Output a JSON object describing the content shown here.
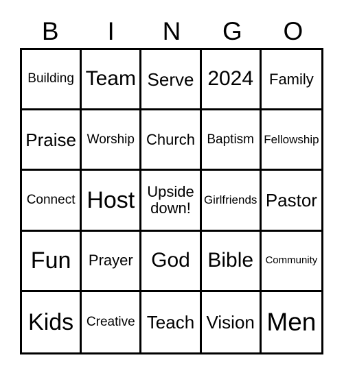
{
  "card": {
    "title": "BINGO",
    "columns": [
      "B",
      "I",
      "N",
      "G",
      "O"
    ],
    "border_color": "#000000",
    "background_color": "#ffffff",
    "text_color": "#000000",
    "rows": 5,
    "cols": 5
  },
  "header": {
    "letters": [
      {
        "label": "B"
      },
      {
        "label": "I"
      },
      {
        "label": "N"
      },
      {
        "label": "G"
      },
      {
        "label": "O"
      }
    ]
  },
  "grid": {
    "cells": [
      {
        "label": "Building",
        "size": "md",
        "row": 1,
        "col": 1
      },
      {
        "label": "Team",
        "size": "2xl",
        "row": 1,
        "col": 2
      },
      {
        "label": "Serve",
        "size": "xl",
        "row": 1,
        "col": 3
      },
      {
        "label": "2024",
        "size": "2xl",
        "row": 1,
        "col": 4
      },
      {
        "label": "Family",
        "size": "lg",
        "row": 1,
        "col": 5
      },
      {
        "label": "Praise",
        "size": "xl",
        "row": 2,
        "col": 1
      },
      {
        "label": "Worship",
        "size": "md",
        "row": 2,
        "col": 2
      },
      {
        "label": "Church",
        "size": "lg",
        "row": 2,
        "col": 3
      },
      {
        "label": "Baptism",
        "size": "md",
        "row": 2,
        "col": 4
      },
      {
        "label": "Fellowship",
        "size": "sm",
        "row": 2,
        "col": 5
      },
      {
        "label": "Connect",
        "size": "md",
        "row": 3,
        "col": 1
      },
      {
        "label": "Host",
        "size": "3xl",
        "row": 3,
        "col": 2
      },
      {
        "label": "Upside\ndown!",
        "size": "lg",
        "row": 3,
        "col": 3
      },
      {
        "label": "Girlfriends",
        "size": "sm",
        "row": 3,
        "col": 4
      },
      {
        "label": "Pastor",
        "size": "xl",
        "row": 3,
        "col": 5
      },
      {
        "label": "Fun",
        "size": "3xl",
        "row": 4,
        "col": 1
      },
      {
        "label": "Prayer",
        "size": "lg",
        "row": 4,
        "col": 2
      },
      {
        "label": "God",
        "size": "2xl",
        "row": 4,
        "col": 3
      },
      {
        "label": "Bible",
        "size": "2xl",
        "row": 4,
        "col": 4
      },
      {
        "label": "Community",
        "size": "xs",
        "row": 4,
        "col": 5
      },
      {
        "label": "Kids",
        "size": "3xl",
        "row": 5,
        "col": 1
      },
      {
        "label": "Creative",
        "size": "md",
        "row": 5,
        "col": 2
      },
      {
        "label": "Teach",
        "size": "xl",
        "row": 5,
        "col": 3
      },
      {
        "label": "Vision",
        "size": "xl",
        "row": 5,
        "col": 4
      },
      {
        "label": "Men",
        "size": "4xl",
        "row": 5,
        "col": 5
      }
    ]
  }
}
